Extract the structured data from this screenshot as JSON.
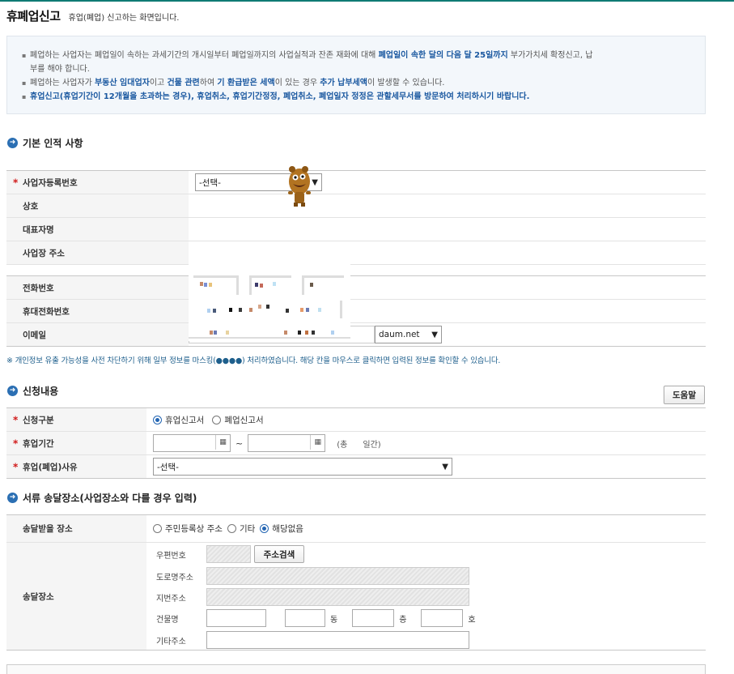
{
  "page": {
    "title": "휴폐업신고",
    "subtitle": "휴업(폐업) 신고하는 화면입니다."
  },
  "notice": {
    "line1_a": "폐업하는 사업자는 폐업일이 속하는 과세기간의 개시일부터 폐업일까지의 사업실적과 잔존 재화에 대해 ",
    "line1_hl": "폐업일이 속한 달의 다음 달 25일까지",
    "line1_b": " 부가가치세 확정신고, 납",
    "line1_c": "부를 해야 합니다.",
    "line2_a": "폐업하는 사업자가 ",
    "line2_hl1": "부동산 임대업자",
    "line2_b": "이고 ",
    "line2_hl2": "건물 관련",
    "line2_c": "하여 ",
    "line2_hl3": "기 환급받은 세액",
    "line2_d": "이 있는 경우 ",
    "line2_hl4": "추가 납부세액",
    "line2_e": "이 발생할 수 있습니다.",
    "line3": "휴업신고(휴업기간이 12개월을 초과하는 경우), 휴업취소, 휴업기간정정, 폐업취소, 폐업일자 정정은 관할세무서를 방문하여 처리하시기 바랍니다."
  },
  "basic": {
    "section_title": "기본 인적 사항",
    "biz_no_label": "사업자등록번호",
    "biz_no_value": "-선택-",
    "company_label": "상호",
    "rep_label": "대표자명",
    "addr_label": "사업장 주소",
    "phone_label": "전화번호",
    "mobile_label": "휴대전화번호",
    "email_label": "이메일",
    "email_domain": "daum.net"
  },
  "privacy_note": "※ 개인정보 유출 가능성을 사전 차단하기 위해 일부 정보를 마스킹(●●●●) 처리하였습니다. 해당 칸을 마우스로 클릭하면 입력된 정보를 확인할 수 있습니다.",
  "apply": {
    "section_title": "신청내용",
    "help_button": "도움말",
    "type_label": "신청구분",
    "type_opt1": "휴업신고서",
    "type_opt2": "폐업신고서",
    "period_label": "휴업기간",
    "period_sep": "~",
    "period_total": "(총      일간)",
    "reason_label": "휴업(폐업)사유",
    "reason_value": "-선택-"
  },
  "delivery": {
    "section_title": "서류 송달장소(사업장소와 다를 경우 입력)",
    "place_label": "송달받을 장소",
    "place_opt1": "주민등록상 주소",
    "place_opt2": "기타",
    "place_opt3": "해당없음",
    "addr_label": "송달장소",
    "zip_label": "우편번호",
    "search_button": "주소검색",
    "road_label": "도로명주소",
    "lot_label": "지번주소",
    "bldg_label": "건물명",
    "dong_unit": "동",
    "floor_unit": "층",
    "ho_unit": "호",
    "etc_label": "기타주소"
  }
}
